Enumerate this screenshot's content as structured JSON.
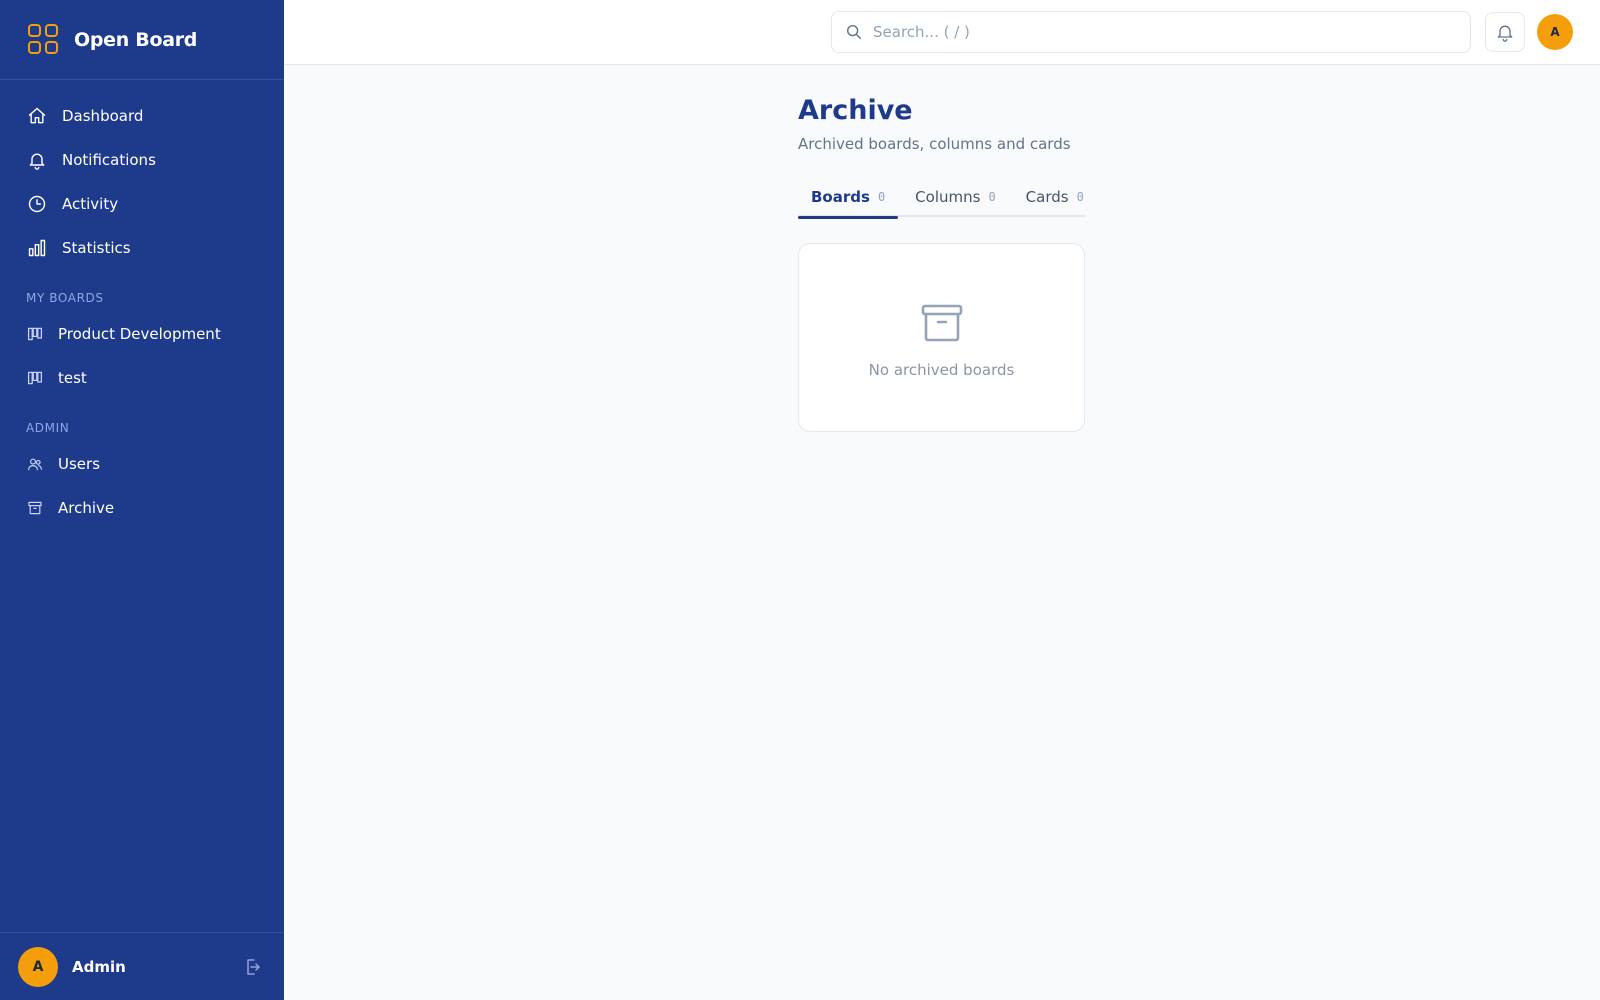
{
  "app": {
    "name": "Open Board"
  },
  "sidebar": {
    "nav": [
      {
        "label": "Dashboard",
        "icon": "home-icon"
      },
      {
        "label": "Notifications",
        "icon": "bell-icon"
      },
      {
        "label": "Activity",
        "icon": "clock-icon"
      },
      {
        "label": "Statistics",
        "icon": "bar-chart-icon"
      }
    ],
    "boards_section": "MY BOARDS",
    "boards": [
      {
        "label": "Product Development",
        "icon": "board-icon"
      },
      {
        "label": "test",
        "icon": "board-icon"
      }
    ],
    "admin_section": "ADMIN",
    "admin": [
      {
        "label": "Users",
        "icon": "users-icon"
      },
      {
        "label": "Archive",
        "icon": "archive-icon"
      }
    ],
    "footer": {
      "avatar_initial": "A",
      "user_name": "Admin"
    }
  },
  "topbar": {
    "search_placeholder": "Search... ( / )",
    "avatar_initial": "A"
  },
  "page": {
    "title": "Archive",
    "subtitle": "Archived boards, columns and cards",
    "tabs": [
      {
        "label": "Boards",
        "count": "0",
        "active": true
      },
      {
        "label": "Columns",
        "count": "0",
        "active": false
      },
      {
        "label": "Cards",
        "count": "0",
        "active": false
      }
    ],
    "empty_message": "No archived boards"
  },
  "colors": {
    "sidebar_bg": "#1e3a8a",
    "accent": "#f59e0b",
    "page_bg": "#f8fafc"
  }
}
